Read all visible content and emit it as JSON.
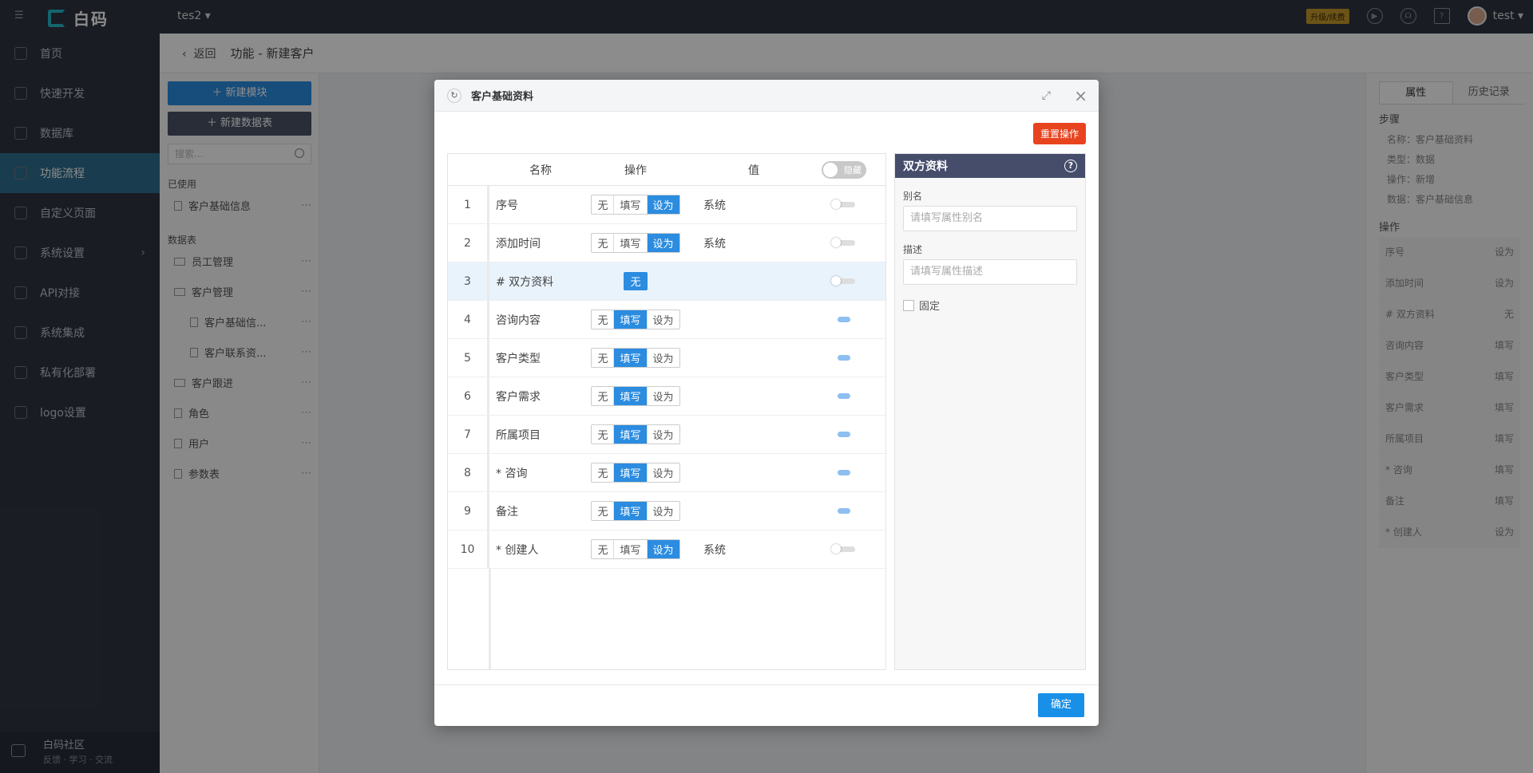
{
  "topbar": {
    "logo_text": "白码",
    "project": "tes2 ▾",
    "upgrade": "升级/续费",
    "user": "test ▾",
    "accent": "#2f3441"
  },
  "sidebar": {
    "items": [
      {
        "label": "首页",
        "icon": "home-icon"
      },
      {
        "label": "快速开发",
        "icon": "cube-icon"
      },
      {
        "label": "数据库",
        "icon": "database-icon"
      },
      {
        "label": "功能流程",
        "icon": "flow-icon"
      },
      {
        "label": "自定义页面",
        "icon": "page-icon"
      },
      {
        "label": "系统设置",
        "icon": "settings-icon"
      },
      {
        "label": "API对接",
        "icon": "api-icon"
      },
      {
        "label": "系统集成",
        "icon": "layers-icon"
      },
      {
        "label": "私有化部署",
        "icon": "lock-icon"
      },
      {
        "label": "logo设置",
        "icon": "logo-icon"
      }
    ],
    "community_title": "白码社区",
    "community_sub": "反馈 · 学习 · 交流"
  },
  "breadcrumb": {
    "back": "返回",
    "title": "功能 - 新建客户"
  },
  "leftpanel": {
    "new_module": "＋  新建模块",
    "new_table": "＋  新建数据表",
    "search_placeholder": "搜索...",
    "used_label": "已使用",
    "used_items": [
      "客户基础信息"
    ],
    "tables_label": "数据表",
    "tree": [
      "员工管理",
      "客户管理",
      "客户基础信...",
      "客户联系资...",
      "客户跟进",
      "角色",
      "用户",
      "参数表"
    ]
  },
  "rightpanel": {
    "tabs": [
      "属性",
      "历史记录"
    ],
    "steps_label": "步骤",
    "steps": [
      "名称：客户基础资料",
      "类型：数据",
      "操作：新增",
      "数据：客户基础信息"
    ],
    "ops_label": "操作",
    "ops": [
      [
        "序号",
        "设为"
      ],
      [
        "添加时间",
        "设为"
      ],
      [
        "# 双方资料",
        "无"
      ],
      [
        "咨询内容",
        "填写"
      ],
      [
        "客户类型",
        "填写"
      ],
      [
        "客户需求",
        "填写"
      ],
      [
        "所属项目",
        "填写"
      ],
      [
        "* 咨询",
        "填写"
      ],
      [
        "备注",
        "填写"
      ],
      [
        "* 创建人",
        "设为"
      ]
    ]
  },
  "modal": {
    "title": "客户基础资料",
    "reset": "重置操作",
    "ok": "确定",
    "headers": {
      "name": "名称",
      "op": "操作",
      "val": "值",
      "hide": "隐藏"
    },
    "seg": [
      "无",
      "填写",
      "设为"
    ],
    "rows": [
      {
        "idx": "1",
        "name": "序号",
        "sel": 2,
        "val": "系统"
      },
      {
        "idx": "2",
        "name": "添加时间",
        "sel": 2,
        "val": "系统"
      },
      {
        "idx": "3",
        "name": "# 双方资料",
        "solo": "无",
        "val": ""
      },
      {
        "idx": "4",
        "name": "咨询内容",
        "sel": 1,
        "val": ""
      },
      {
        "idx": "5",
        "name": "客户类型",
        "sel": 1,
        "val": ""
      },
      {
        "idx": "6",
        "name": "客户需求",
        "sel": 1,
        "val": ""
      },
      {
        "idx": "7",
        "name": "所属项目",
        "sel": 1,
        "val": ""
      },
      {
        "idx": "8",
        "name": "* 咨询",
        "sel": 1,
        "val": ""
      },
      {
        "idx": "9",
        "name": "备注",
        "sel": 1,
        "val": ""
      },
      {
        "idx": "10",
        "name": "* 创建人",
        "sel": 2,
        "val": "系统"
      }
    ],
    "prop": {
      "title": "双方资料",
      "alias_label": "别名",
      "alias_placeholder": "请填写属性别名",
      "desc_label": "描述",
      "desc_placeholder": "请填写属性描述",
      "fixed_label": "固定"
    }
  }
}
